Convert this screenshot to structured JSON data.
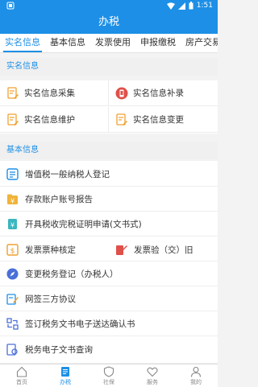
{
  "status": {
    "time": "1:51"
  },
  "header": {
    "title": "办税"
  },
  "tabs": [
    {
      "label": "实名信息",
      "active": true
    },
    {
      "label": "基本信息"
    },
    {
      "label": "发票使用"
    },
    {
      "label": "申报缴税"
    },
    {
      "label": "房产交易"
    }
  ],
  "sections": {
    "realname": {
      "title": "实名信息",
      "items": [
        {
          "label": "实名信息采集",
          "icon": "doc-edit-icon"
        },
        {
          "label": "实名信息补录",
          "icon": "phone-doc-icon"
        },
        {
          "label": "实名信息维护",
          "icon": "doc-edit-icon"
        },
        {
          "label": "实名信息变更",
          "icon": "doc-edit-icon"
        }
      ]
    },
    "basic": {
      "title": "基本信息",
      "rows": [
        {
          "label": "增值税一般纳税人登记",
          "icon": "list-icon"
        },
        {
          "label": "存款账户账号报告",
          "icon": "yen-folder-icon"
        },
        {
          "label": "开具税收完税证明申请(文书式)",
          "icon": "yen-doc-icon"
        },
        {
          "label": "发票票种核定",
          "icon": "invoice-icon",
          "right_label": "发票验（交）旧",
          "right_icon": "invoice-check-icon"
        },
        {
          "label": "变更税务登记（办税人）",
          "icon": "compass-icon"
        },
        {
          "label": "网签三方协议",
          "icon": "pen-doc-icon"
        },
        {
          "label": "签订税务文书电子送达确认书",
          "icon": "transfer-icon"
        },
        {
          "label": "税务电子文书查询",
          "icon": "doc-search-icon"
        }
      ]
    }
  },
  "bottom_nav": [
    {
      "label": "首页",
      "icon": "home-icon"
    },
    {
      "label": "办税",
      "icon": "tax-doc-icon",
      "active": true
    },
    {
      "label": "社保",
      "icon": "shield-icon"
    },
    {
      "label": "服务",
      "icon": "heart-icon"
    },
    {
      "label": "我的",
      "icon": "user-icon"
    }
  ],
  "colors": {
    "primary": "#1d8fe6",
    "orange": "#f0a030",
    "red": "#e0504a"
  }
}
